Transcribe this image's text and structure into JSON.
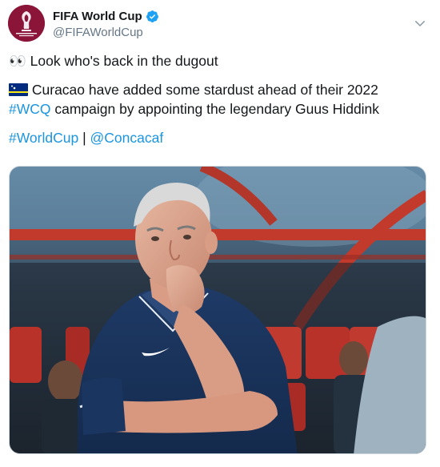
{
  "account": {
    "display_name": "FIFA World Cup",
    "handle": "@FIFAWorldCup",
    "verified": true,
    "avatar_icon": "fifa-world-cup-qatar-2022-logo",
    "avatar_text": "FIFA WORLD CUP Qatar 2022"
  },
  "menu": {
    "icon": "chevron-down-icon"
  },
  "tweet": {
    "line1_emoji": "👀",
    "line1_text": "Look who's back in the dugout",
    "line2_flag": "flag-of-curacao-icon",
    "line2_text": "Curacao have added some stardust ahead of their 2022",
    "line3_hashtag": "#WCQ",
    "line3_text": " campaign by appointing the legendary Guus Hiddink",
    "tag_worldcup": "#WorldCup",
    "separator": " | ",
    "mention_concacaf": "@Concacaf"
  },
  "media": {
    "description_icon": "photo-man-in-navy-polo-in-dugout"
  },
  "colors": {
    "link": "#1b95e0",
    "brand": "#8a1538",
    "text": "#14171a",
    "muted": "#657786"
  }
}
